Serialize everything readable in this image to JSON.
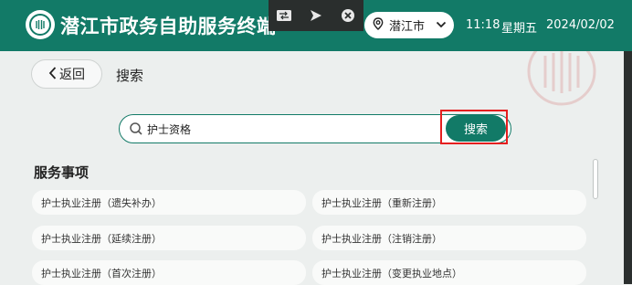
{
  "header": {
    "title": "潜江市政务自助服务终端",
    "location": "潜江市",
    "time": "11:18",
    "weekday": "星期五",
    "date": "2024/02/02"
  },
  "toolbar": {
    "icons": [
      "screen-icon",
      "send-icon",
      "close-icon"
    ]
  },
  "nav": {
    "back_label": "返回",
    "page_title": "搜索"
  },
  "search": {
    "value": "护士资格",
    "button_label": "搜索"
  },
  "services": {
    "section_title": "服务事项",
    "items": [
      "护士执业注册（遗失补办）",
      "护士执业注册（重新注册）",
      "护士执业注册（延续注册）",
      "护士执业注册（注销注册）",
      "护士执业注册（首次注册）",
      "护士执业注册（变更执业地点）"
    ]
  },
  "colors": {
    "brand": "#127a67",
    "highlight": "#e51f1f"
  }
}
